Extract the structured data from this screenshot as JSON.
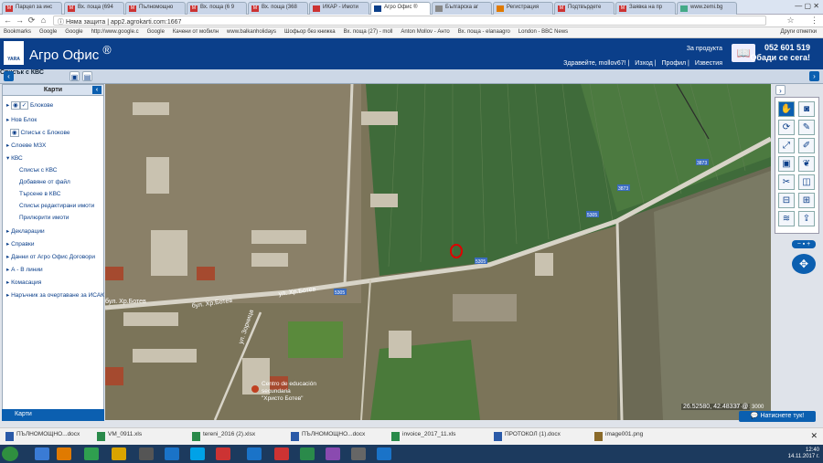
{
  "browser": {
    "tabs": [
      "Парцел за инс",
      "Вх. поща (694",
      "Пълномощно ",
      "Вх. поща (6 9",
      "Вх. поща (368",
      "ИКАР - Имоти",
      "Агро Офис ®",
      "Българска аг",
      "Регистрация",
      "Подтвърдете",
      "Заявка на пр",
      "www.zemi.bg"
    ],
    "active_tab": 6,
    "security": "Няма защита",
    "url": "app2.agrokarti.com:1667",
    "bookmarks": [
      "Bookmarks",
      "Google",
      "Google",
      "http://www.google.c",
      "Google",
      "Качени от мобилн",
      "www.balkanholidays",
      "Шофьор без книжка",
      "Вх. поща (27) - moll",
      "Anton Mollov - Анто",
      "Вх. поща - elanaagro",
      "London - BBC News",
      "Други отметки"
    ]
  },
  "app": {
    "brand": "YARA",
    "title": "Агро Офис",
    "reg": "®",
    "about": "За продукта",
    "greeting": "Здравейте, mollov67!",
    "links": [
      "Изход",
      "Профил",
      "Известия"
    ],
    "phone": "052 601 519",
    "phone_sub": "Обади се сега!"
  },
  "toolbar": {
    "list_label": "Списък с КВС"
  },
  "sidebar": {
    "title": "Карти",
    "items": [
      {
        "label": "Блокове",
        "sub": false
      },
      {
        "label": "Нов Блок",
        "sub": false
      },
      {
        "label": "Списък с Блокове",
        "sub": true
      },
      {
        "label": "Слоеве МЗХ",
        "sub": false
      },
      {
        "label": "КВС",
        "sub": false
      },
      {
        "label": "Списък с КВС",
        "sub": true
      },
      {
        "label": "Добавяне от файл",
        "sub": true
      },
      {
        "label": "Търсене в КВС",
        "sub": true
      },
      {
        "label": "Списък редактирани имоти",
        "sub": true
      },
      {
        "label": "Прилюрити имоти",
        "sub": true
      },
      {
        "label": "Декларации",
        "sub": false
      },
      {
        "label": "Справки",
        "sub": false
      },
      {
        "label": "Данни от Агро Офис Договори",
        "sub": false
      },
      {
        "label": "А - В линии",
        "sub": false
      },
      {
        "label": "Комасация",
        "sub": false
      },
      {
        "label": "Наръчник за очертаване за ИСАК",
        "sub": false
      }
    ],
    "footer": "Карти"
  },
  "map": {
    "roads": [
      "бул. Хр.Ботев",
      "ул. Хр.Ботев",
      "ул. Зорница",
      "бул. Хр.Ботев"
    ],
    "poi": [
      "Centro de educación",
      "secundaria",
      "\"Христо Ботев\""
    ],
    "road_badges": [
      "5305",
      "5305",
      "5305",
      "3873",
      "3873"
    ],
    "coords": "26.52580, 42.48337 @",
    "scale": "0 - 1 : 3000"
  },
  "tools": [
    "hand-icon",
    "camera-icon",
    "refresh-icon",
    "ruler-icon",
    "expand-icon",
    "edit-icon",
    "select-icon",
    "footprint-icon",
    "scissors-icon",
    "split-icon",
    "merge-icon",
    "grid-icon",
    "layers-icon",
    "upload-icon"
  ],
  "chat": "Натиснете тук!",
  "downloads": [
    "ПЪЛНОМОЩНО...docx",
    "VM_0911.xls",
    "tereni_2016 (2).xlsx",
    "ПЪЛНОМОЩНО...docx",
    "invoice_2017_11.xls",
    "ПРОТОКОЛ (1).docx",
    "image001.png"
  ],
  "clock": {
    "time": "12:40",
    "date": "14.11.2017 г."
  },
  "colors": {
    "brand": "#0b3f8a",
    "accent": "#0b5fb0",
    "marker": "#e00000"
  }
}
